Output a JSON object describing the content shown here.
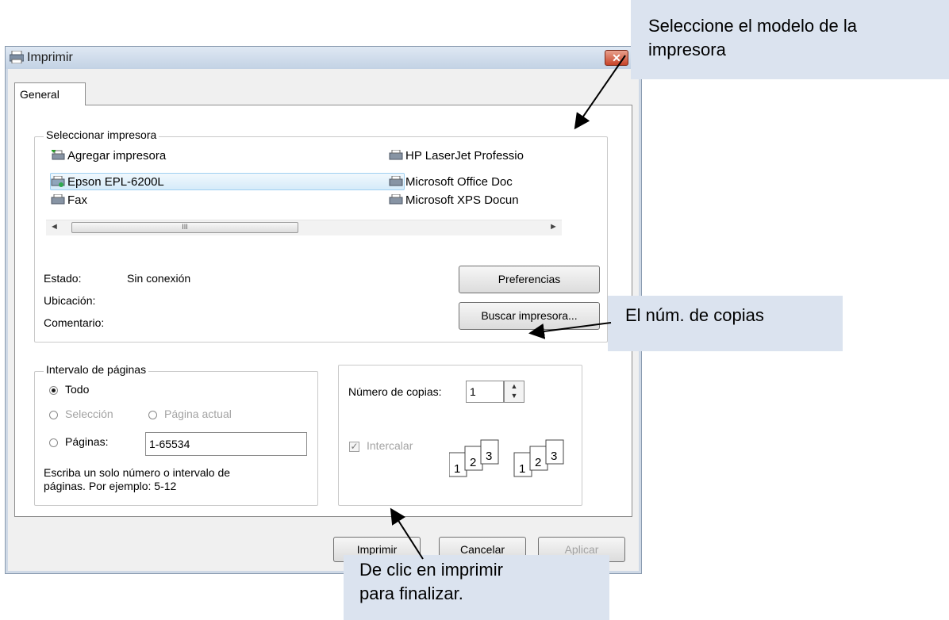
{
  "dialog": {
    "title": "Imprimir",
    "close_label": "✕"
  },
  "tabs": [
    {
      "label": "General"
    }
  ],
  "select_printer": {
    "legend": "Seleccionar impresora",
    "printers_left": [
      {
        "name": "Agregar impresora",
        "icon": "add-printer-icon"
      },
      {
        "name": "Epson EPL-6200L",
        "icon": "printer-icon"
      },
      {
        "name": "Fax",
        "icon": "fax-icon"
      }
    ],
    "printers_right": [
      {
        "name": "HP LaserJet Professio",
        "icon": "printer-icon"
      },
      {
        "name": "Microsoft Office Doc",
        "icon": "printer-icon"
      },
      {
        "name": "Microsoft XPS Docun",
        "icon": "printer-icon"
      }
    ],
    "selected": "Epson EPL-6200L",
    "scroll_thumb": "III",
    "status_label": "Estado:",
    "status_value": "Sin conexión",
    "location_label": "Ubicación:",
    "comment_label": "Comentario:",
    "preferences_button": "Preferencias",
    "find_button": "Buscar impresora..."
  },
  "page_range": {
    "legend": "Intervalo de páginas",
    "all_label": "Todo",
    "selection_label": "Selección",
    "current_label": "Página actual",
    "pages_label": "Páginas:",
    "pages_value": "1-65534",
    "hint_line1": "Escriba un solo número o intervalo de",
    "hint_line2": "páginas. Por ejemplo: 5-12"
  },
  "copies": {
    "label": "Número de copias:",
    "value": "1",
    "collate_label": "Intercalar"
  },
  "buttons": {
    "print": "Imprimir",
    "cancel": "Cancelar",
    "apply": "Aplicar"
  },
  "callouts": {
    "model_line1": "Seleccione el modelo de la",
    "model_line2": "impresora",
    "copies": "El núm.  de copias",
    "print_line1": "De clic en imprimir",
    "print_line2": "para finalizar."
  }
}
